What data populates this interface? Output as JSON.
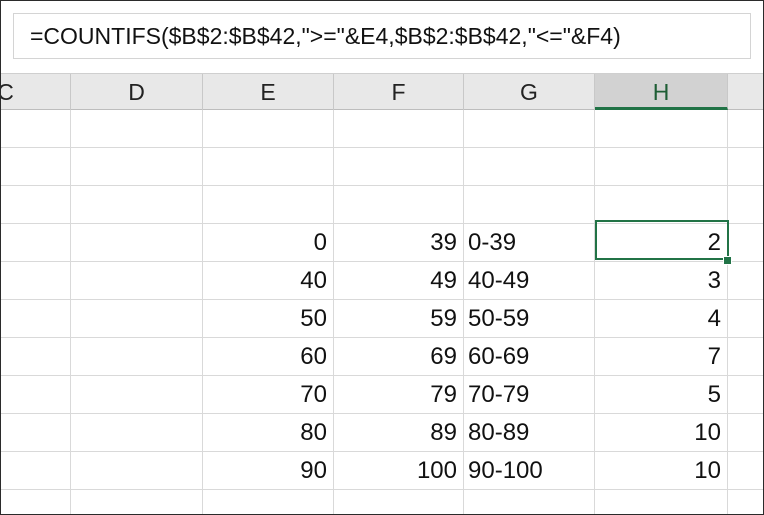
{
  "formula_bar": {
    "formula": "=COUNTIFS($B$2:$B$42,\">=\"&E4,$B$2:$B$42,\"<=\"&F4)"
  },
  "columns": [
    {
      "id": "C",
      "label": "C",
      "active": false
    },
    {
      "id": "D",
      "label": "D",
      "active": false
    },
    {
      "id": "E",
      "label": "E",
      "active": false
    },
    {
      "id": "F",
      "label": "F",
      "active": false
    },
    {
      "id": "G",
      "label": "G",
      "active": false
    },
    {
      "id": "H",
      "label": "H",
      "active": true
    }
  ],
  "selected_cell": "H4",
  "rows": [
    {
      "E": "",
      "F": "",
      "G": "",
      "H": ""
    },
    {
      "E": "",
      "F": "",
      "G": "",
      "H": ""
    },
    {
      "E": "",
      "F": "",
      "G": "",
      "H": ""
    },
    {
      "E": "0",
      "F": "39",
      "G": "0-39",
      "H": "2"
    },
    {
      "E": "40",
      "F": "49",
      "G": "40-49",
      "H": "3"
    },
    {
      "E": "50",
      "F": "59",
      "G": "50-59",
      "H": "4"
    },
    {
      "E": "60",
      "F": "69",
      "G": "60-69",
      "H": "7"
    },
    {
      "E": "70",
      "F": "79",
      "G": "70-79",
      "H": "5"
    },
    {
      "E": "80",
      "F": "89",
      "G": "80-89",
      "H": "10"
    },
    {
      "E": "90",
      "F": "100",
      "G": "90-100",
      "H": "10"
    },
    {
      "E": "",
      "F": "",
      "G": "",
      "H": ""
    }
  ],
  "colors": {
    "selection": "#217346",
    "header_bg": "#e8e8e8",
    "gridline": "#d9d9d9"
  }
}
